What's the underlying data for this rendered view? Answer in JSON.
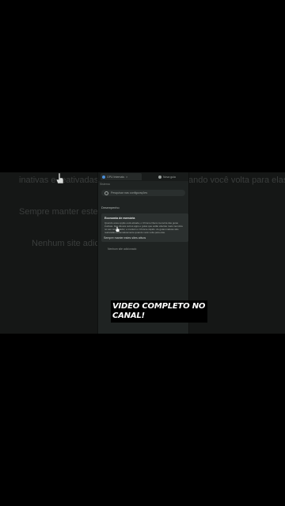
{
  "background": {
    "line1": "inativas e reativadas",
    "line1_tail": "ando você volta para elas",
    "line2": "Sempre manter estes",
    "line3": "Nenhum site adic"
  },
  "tabs": [
    {
      "label": "GPU Internals"
    },
    {
      "label": "Nova guia"
    }
  ],
  "nav": {
    "breadcrumb": "Sistema"
  },
  "search": {
    "placeholder": "Pesquisar nas configurações"
  },
  "section": {
    "title": "Desempenho"
  },
  "memory_card": {
    "title": "Economia de memória",
    "description": "Quando essa opção está ativada, o Chrome libera memória das guias inativas. Isso dá aos outros apps e guias que estão abertas mais memória no seu computador, e mantém o Chrome rápido. As guias inativas são reativadas automaticamente quando você volta para elas."
  },
  "always_active": {
    "title": "Sempre manter estes sites ativos"
  },
  "empty_state": {
    "text": "Nenhum site adicionado"
  },
  "overlay": {
    "line1": "VIDEO COMPLETO NO",
    "line2": "CANAL!"
  },
  "colors": {
    "accent": "#4b8fd8",
    "panel": "#1f2322",
    "card": "#2b302f"
  }
}
